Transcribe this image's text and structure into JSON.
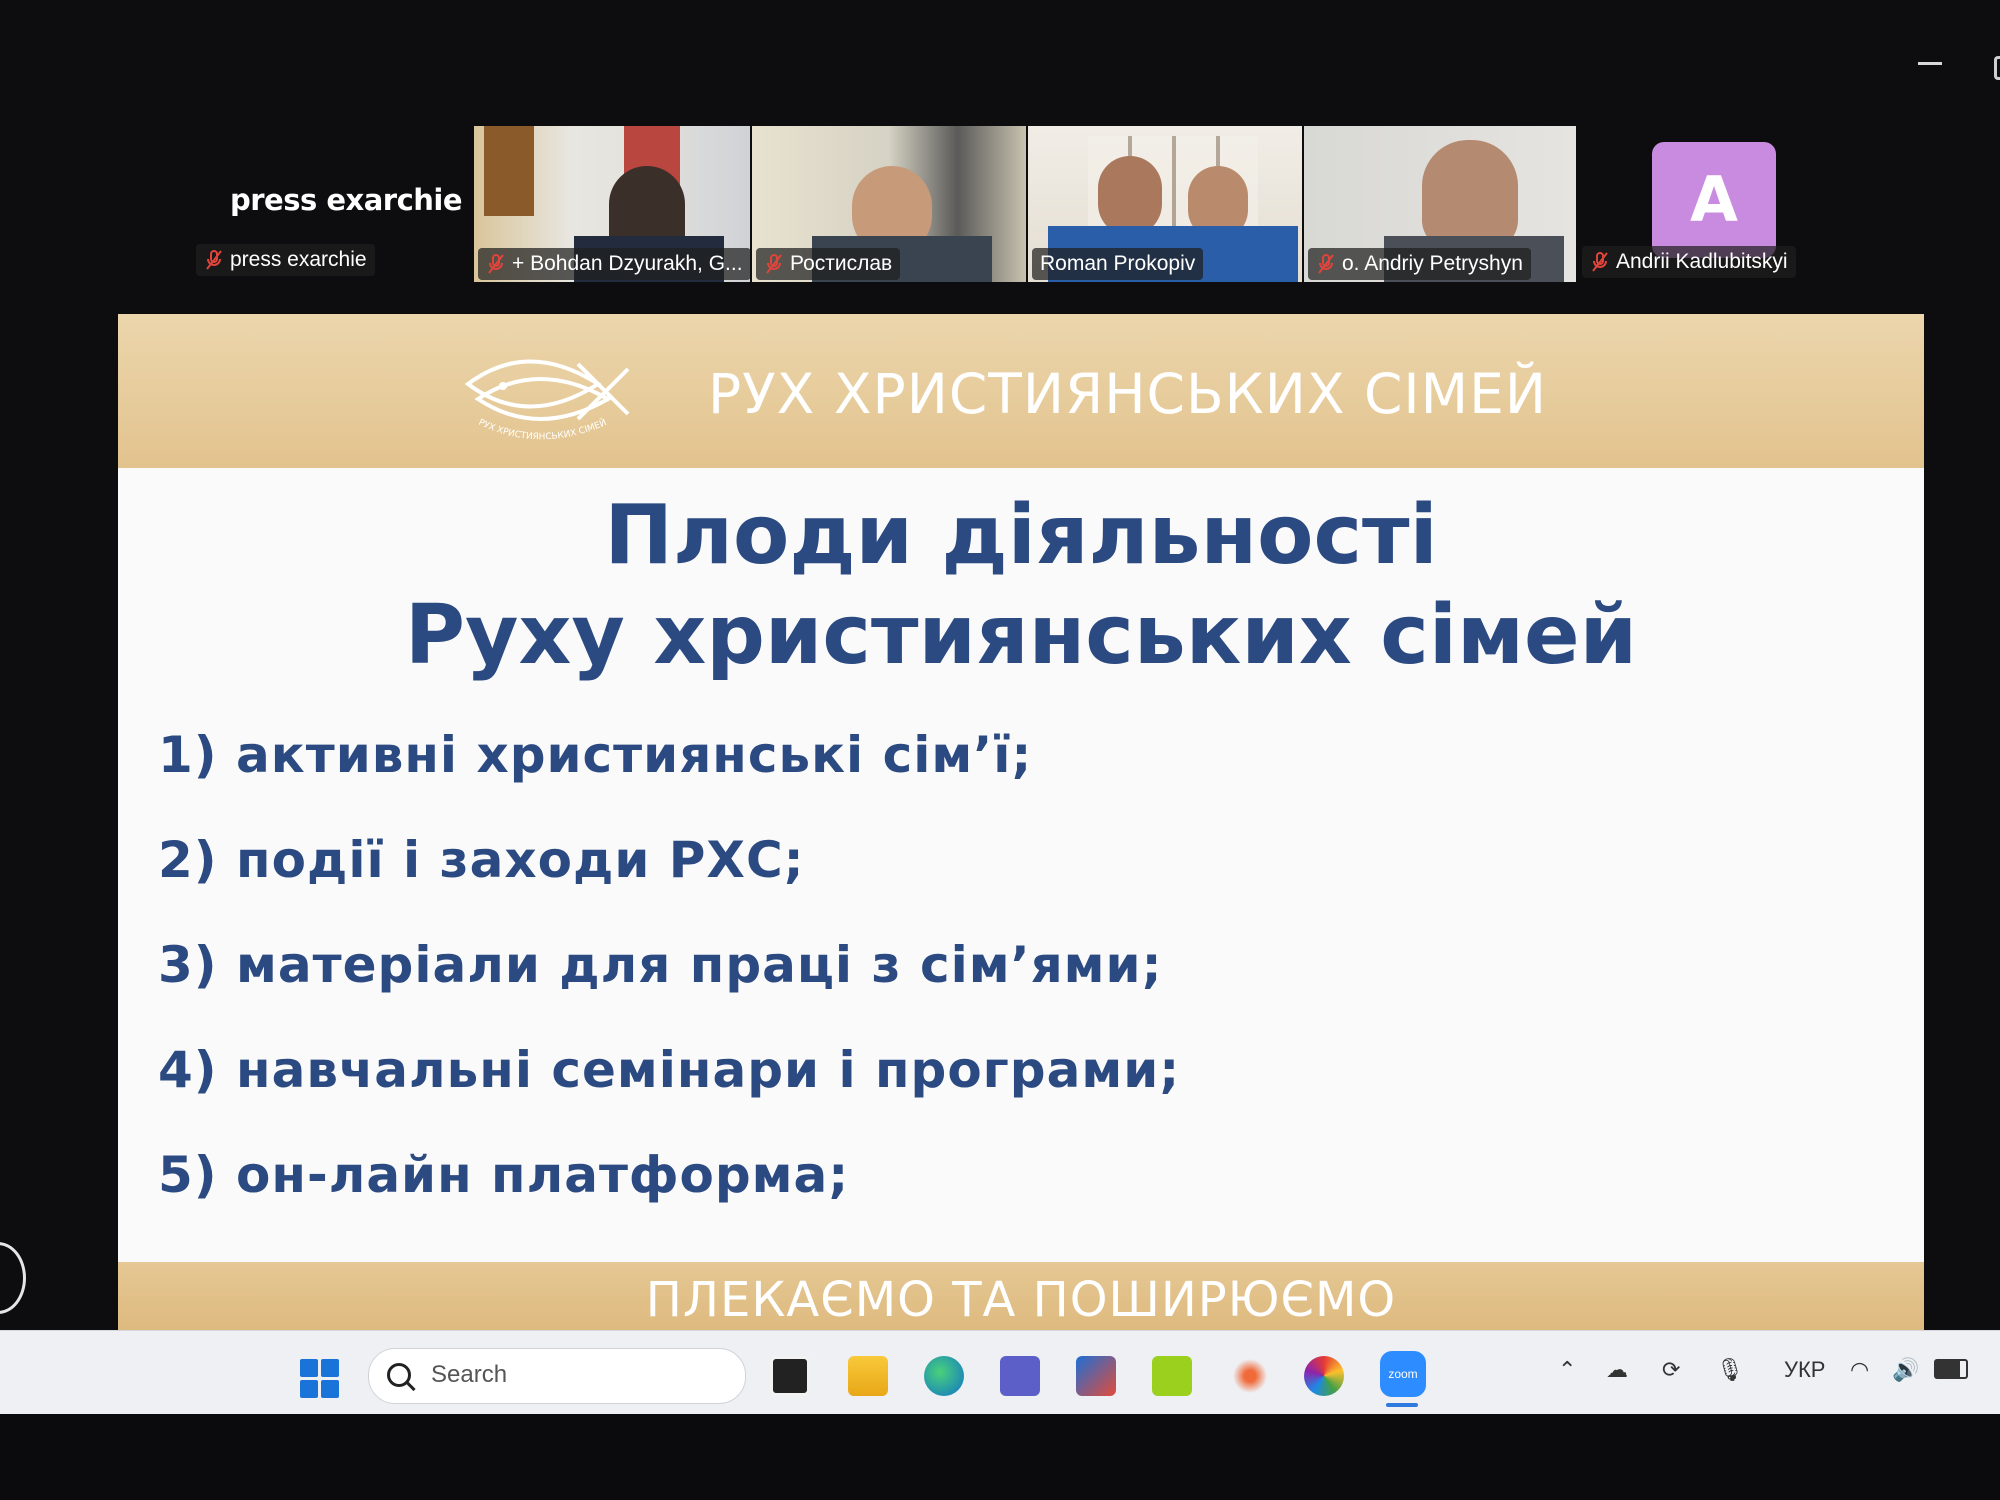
{
  "participants": {
    "self": {
      "display_name": "press exarchie",
      "tag": "press exarchie"
    },
    "tiles": [
      {
        "name": "+ Bohdan Dzyurakh, G..."
      },
      {
        "name": "Ростислав"
      },
      {
        "name": "Roman Prokopiv"
      },
      {
        "name": "o. Andriy Petryshyn"
      }
    ],
    "avatar": {
      "letter": "A",
      "name": "Andrii Kadlubitskyi"
    }
  },
  "slide": {
    "header": "РУХ ХРИСТИЯНСЬКИХ СІМЕЙ",
    "logo_text": "РУХ ХРИСТИЯНСЬКИХ СІМЕЙ",
    "title_line1": "Плоди діяльності",
    "title_line2": "Руху християнських сімей",
    "items": [
      "1) активні християнські сім’ї;",
      "2) події і заходи РХС;",
      "3) матеріали для праці з сім’ями;",
      "4) навчальні семінари і програми;",
      "5) он-лайн платформа;"
    ],
    "footer": "ПЛЕКАЄМО ТА ПОШИРЮЄМО"
  },
  "taskbar": {
    "search_placeholder": "Search",
    "zoom_label": "zoom",
    "language": "УКР"
  },
  "colors": {
    "slide_text": "#2c4a82",
    "slide_gold": "#e2c38e",
    "active_speaker": "#5dd04a",
    "avatar_bg": "#c98be0"
  }
}
